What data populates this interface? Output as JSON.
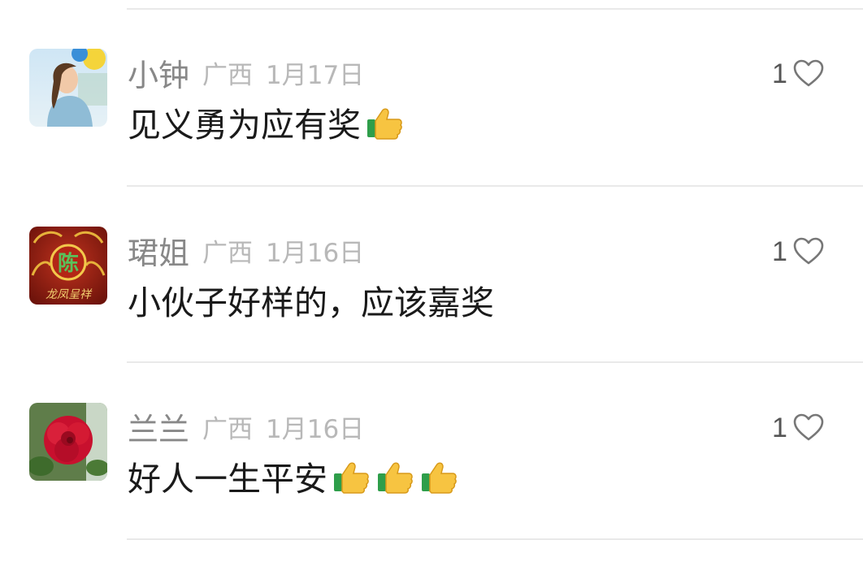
{
  "comments": [
    {
      "username": "小钟",
      "region": "广西",
      "date": "1月17日",
      "text": "见义勇为应有奖",
      "emoji_count": 1,
      "likes": "1",
      "avatar": "woman-photo"
    },
    {
      "username": "珺姐",
      "region": "广西",
      "date": "1月16日",
      "text": "小伙子好样的，应该嘉奖",
      "emoji_count": 0,
      "likes": "1",
      "avatar": "dragon-phoenix-emblem",
      "avatar_text": "陈",
      "avatar_caption": "龙凤呈祥"
    },
    {
      "username": "兰兰",
      "region": "广西",
      "date": "1月16日",
      "text": "好人一生平安",
      "emoji_count": 3,
      "likes": "1",
      "avatar": "red-flower-photo"
    }
  ],
  "icons": {
    "like": "heart-outline-icon",
    "emoji": "thumbs-up-emoji"
  },
  "colors": {
    "username": "#888888",
    "meta": "#b8b8b8",
    "text": "#1a1a1a",
    "divider": "#e9e9e9"
  }
}
